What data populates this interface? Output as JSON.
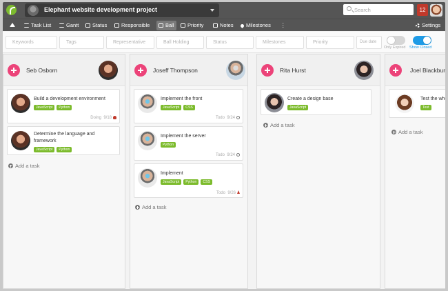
{
  "topbar": {
    "project_title": "Elephant website development project",
    "search_placeholder": "Search",
    "notification_count": "12"
  },
  "nav": {
    "items": [
      {
        "label": "",
        "icon": "home-icon"
      },
      {
        "label": "Task List",
        "icon": "list-icon"
      },
      {
        "label": "Gantt",
        "icon": "gantt-icon"
      },
      {
        "label": "Status",
        "icon": "board-icon"
      },
      {
        "label": "Responsible",
        "icon": "board-icon"
      },
      {
        "label": "Ball",
        "icon": "board-icon",
        "active": true
      },
      {
        "label": "Priority",
        "icon": "board-icon"
      },
      {
        "label": "Notes",
        "icon": "notes-icon"
      },
      {
        "label": "Milestones",
        "icon": "pin-icon"
      },
      {
        "label": "⋮",
        "icon": "more-icon"
      }
    ],
    "settings_label": "Settings"
  },
  "filters": {
    "keywords": "Keywords",
    "tags": "Tags",
    "representative": "Representative",
    "ball_holding": "Ball Holding",
    "status": "Status",
    "milestones": "Milestones",
    "priority": "Priority",
    "due_date": "Due date",
    "only_expired": "Only Expired",
    "show_closed": "Show Closed"
  },
  "columns": [
    {
      "name": "Seb Osborn",
      "cards": [
        {
          "title": "Build a development environment",
          "tags": [
            "JavaScript",
            "Python"
          ],
          "status": "Doing",
          "date": "9/18"
        },
        {
          "title": "Determine the language and framework",
          "tags": [
            "JavaScript",
            "Python"
          ],
          "status": "",
          "date": ""
        }
      ],
      "add_label": "Add a task"
    },
    {
      "name": "Joseff Thompson",
      "cards": [
        {
          "title": "Implement the front",
          "tags": [
            "JavaScript",
            "CSS"
          ],
          "status": "Todo",
          "date": "9/24"
        },
        {
          "title": "Implement the server",
          "tags": [
            "Python"
          ],
          "status": "Todo",
          "date": "9/24"
        },
        {
          "title": "Implement",
          "tags": [
            "JavaScript",
            "Python",
            "CSS"
          ],
          "status": "Todo",
          "date": "9/26"
        }
      ],
      "add_label": "Add a task"
    },
    {
      "name": "Rita Hurst",
      "cards": [
        {
          "title": "Create a design base",
          "tags": [
            "JavaScript"
          ],
          "status": "",
          "date": ""
        }
      ],
      "add_label": "Add a task"
    },
    {
      "name": "Joel Blackburn",
      "cards": [
        {
          "title": "Test the whole",
          "tags": [
            "Test"
          ],
          "status": "",
          "date": ""
        }
      ],
      "add_label": "Add a task"
    }
  ],
  "colors": {
    "accent_pink": "#ec4379",
    "tag_green": "#7cbb2c",
    "toggle_blue": "#1e9be6",
    "notif_red": "#c0392b"
  }
}
